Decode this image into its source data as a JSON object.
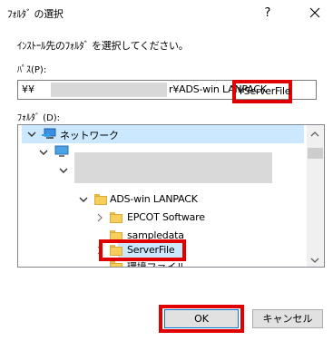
{
  "window": {
    "title": "ﾌｫﾙﾀﾞ の選択",
    "help_label": "?"
  },
  "instruction": "ｲﾝｽﾄｰﾙ先のﾌｫﾙﾀﾞ を選択してください。",
  "path": {
    "label": "ﾊﾟｽ(P):",
    "prefix": "¥¥",
    "middle": "r¥ADS-win LANPACK",
    "end": "¥ServerFile"
  },
  "folder_label": "ﾌｫﾙﾀﾞ (D):",
  "tree": {
    "network": "ネットワーク",
    "ads_win": "ADS-win LANPACK",
    "epcot": "EPCOT Software",
    "sampledata": "sampledata",
    "serverfile": "ServerFile",
    "env": "環境ファイル"
  },
  "buttons": {
    "ok": "OK",
    "cancel": "キャンセル"
  },
  "colors": {
    "highlight_red": "#e10000",
    "selection_blue": "#cce8ff",
    "folder_yellow": "#f6cf5a"
  }
}
